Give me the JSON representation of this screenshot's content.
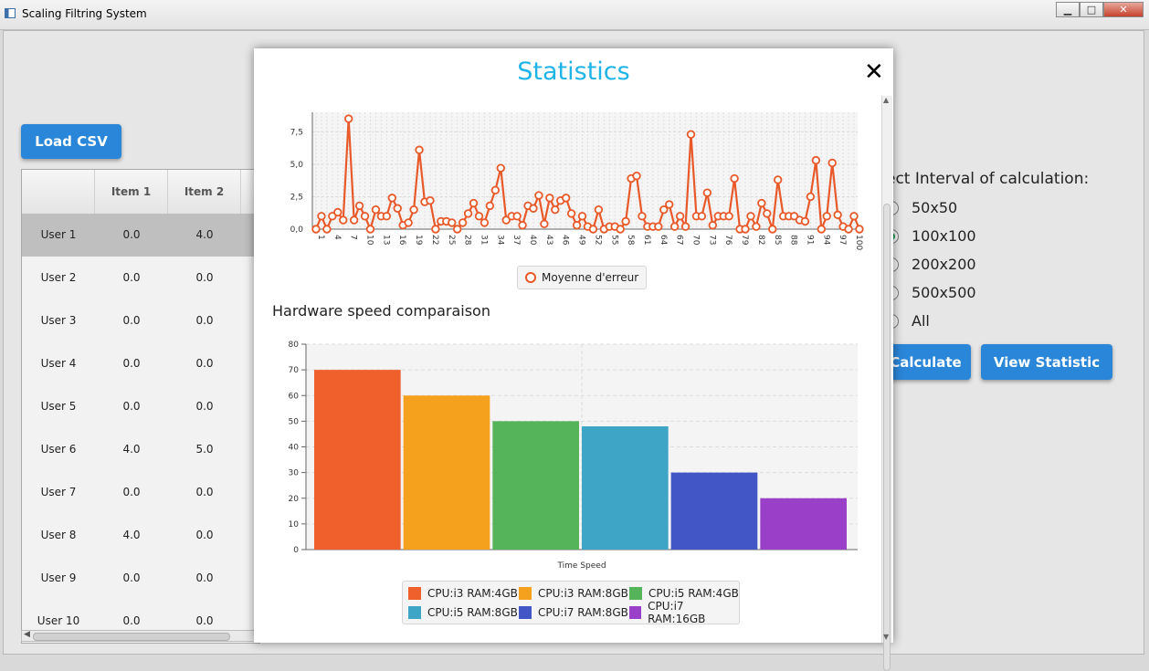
{
  "window": {
    "title": "Scaling Filtring System",
    "minimize": "▁",
    "maximize": "□",
    "close": "✕"
  },
  "toolbar": {
    "load_csv": "Load CSV"
  },
  "table": {
    "headers": [
      "",
      "Item 1",
      "Item 2"
    ],
    "rows": [
      [
        "User 1",
        "0.0",
        "4.0"
      ],
      [
        "User 2",
        "0.0",
        "0.0"
      ],
      [
        "User 3",
        "0.0",
        "0.0"
      ],
      [
        "User 4",
        "0.0",
        "0.0"
      ],
      [
        "User 5",
        "0.0",
        "0.0"
      ],
      [
        "User 6",
        "4.0",
        "5.0"
      ],
      [
        "User 7",
        "0.0",
        "0.0"
      ],
      [
        "User 8",
        "4.0",
        "0.0"
      ],
      [
        "User 9",
        "0.0",
        "0.0"
      ],
      [
        "User 10",
        "0.0",
        "0.0"
      ]
    ],
    "selected_row": 0
  },
  "interval": {
    "label": "ect Interval of calculation:",
    "options": [
      "50x50",
      "100x100",
      "200x200",
      "500x500",
      "All"
    ],
    "selected": 1
  },
  "actions": {
    "calculate": "Calculate",
    "view_statistic": "View Statistic"
  },
  "modal": {
    "title": "Statistics",
    "close_icon": "✕",
    "bar_section_title": "Hardware speed comparaison"
  },
  "colors": {
    "accent": "#2a86d8",
    "title": "#1fb4e8",
    "line": "#e8592a"
  },
  "chart_data": [
    {
      "type": "line",
      "title": "",
      "xlabel": "",
      "ylabel": "",
      "series": [
        {
          "name": "Moyenne d'erreur",
          "color": "#e8592a"
        }
      ],
      "x": [
        1,
        2,
        3,
        4,
        5,
        6,
        7,
        8,
        9,
        10,
        11,
        12,
        13,
        14,
        15,
        16,
        17,
        18,
        19,
        20,
        21,
        22,
        23,
        24,
        25,
        26,
        27,
        28,
        29,
        30,
        31,
        32,
        33,
        34,
        35,
        36,
        37,
        38,
        39,
        40,
        41,
        42,
        43,
        44,
        45,
        46,
        47,
        48,
        49,
        50,
        51,
        52,
        53,
        54,
        55,
        56,
        57,
        58,
        59,
        60,
        61,
        62,
        63,
        64,
        65,
        66,
        67,
        68,
        69,
        70,
        71,
        72,
        73,
        74,
        75,
        76,
        77,
        78,
        79,
        80,
        81,
        82,
        83,
        84,
        85,
        86,
        87,
        88,
        89,
        90,
        91,
        92,
        93,
        94,
        95,
        96,
        97,
        98,
        99,
        100
      ],
      "y": [
        0.0,
        1.0,
        0.0,
        1.0,
        1.3,
        0.7,
        8.5,
        0.7,
        1.8,
        1.0,
        0.0,
        1.5,
        1.0,
        1.0,
        2.4,
        1.6,
        0.3,
        0.5,
        1.5,
        6.1,
        2.1,
        2.2,
        0.0,
        0.6,
        0.6,
        0.5,
        0.0,
        0.5,
        1.2,
        2.0,
        1.0,
        0.5,
        1.8,
        3.0,
        4.7,
        0.7,
        1.0,
        1.0,
        0.3,
        1.8,
        1.6,
        2.6,
        0.4,
        2.4,
        1.5,
        2.2,
        2.4,
        1.2,
        0.3,
        1.0,
        0.2,
        0.0,
        1.5,
        0.0,
        0.2,
        0.2,
        0.0,
        0.6,
        3.9,
        4.1,
        1.0,
        0.2,
        0.2,
        0.2,
        1.5,
        1.9,
        0.2,
        1.0,
        0.2,
        7.3,
        1.0,
        1.0,
        2.8,
        0.3,
        1.0,
        1.0,
        1.0,
        3.9,
        0.0,
        0.0,
        1.0,
        0.2,
        2.0,
        1.2,
        0.0,
        3.8,
        1.0,
        1.0,
        1.0,
        0.7,
        0.6,
        2.5,
        5.3,
        0.0,
        1.0,
        5.1,
        1.1,
        0.2,
        0.0,
        1.0,
        0.0
      ],
      "ylim": [
        0,
        9
      ],
      "yticks": [
        "0,0",
        "2,5",
        "5,0",
        "7,5"
      ],
      "ytick_values": [
        0,
        2.5,
        5.0,
        7.5
      ],
      "xticks": [
        "1",
        "4",
        "7",
        "10",
        "13",
        "16",
        "19",
        "22",
        "25",
        "28",
        "31",
        "34",
        "37",
        "40",
        "43",
        "46",
        "49",
        "52",
        "55",
        "58",
        "61",
        "64",
        "67",
        "70",
        "73",
        "76",
        "79",
        "82",
        "85",
        "88",
        "91",
        "94",
        "97",
        "100"
      ],
      "grid": true,
      "legend": "bottom"
    },
    {
      "type": "bar",
      "title": "Hardware speed comparaison",
      "categories": [
        "Time Speed"
      ],
      "xlabel": "",
      "ylabel": "",
      "series": [
        {
          "name": "CPU:i3 RAM:4GB",
          "values": [
            70
          ],
          "color": "#f0602c"
        },
        {
          "name": "CPU:i3 RAM:8GB",
          "values": [
            60
          ],
          "color": "#f6a11e"
        },
        {
          "name": "CPU:i5 RAM:4GB",
          "values": [
            50
          ],
          "color": "#55b35a"
        },
        {
          "name": "CPU:i5 RAM:8GB",
          "values": [
            48
          ],
          "color": "#3ea5c6"
        },
        {
          "name": "CPU:i7 RAM:8GB",
          "values": [
            30
          ],
          "color": "#4356c6"
        },
        {
          "name": "CPU:i7 RAM:16GB",
          "values": [
            20
          ],
          "color": "#9a3fc8"
        }
      ],
      "ylim": [
        0,
        80
      ],
      "yticks": [
        "0",
        "10",
        "20",
        "30",
        "40",
        "50",
        "60",
        "70",
        "80"
      ],
      "grid": true,
      "legend": "bottom"
    }
  ]
}
